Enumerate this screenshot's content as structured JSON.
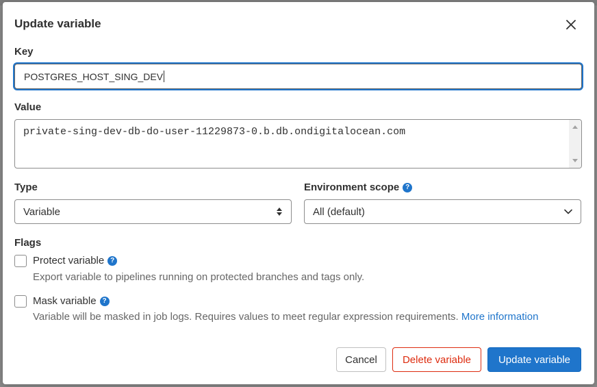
{
  "modal": {
    "title": "Update variable",
    "close_icon": "close-icon"
  },
  "key": {
    "label": "Key",
    "value": "POSTGRES_HOST_SING_DEV"
  },
  "value": {
    "label": "Value",
    "text": "private-sing-dev-db-do-user-11229873-0.b.db.ondigitalocean.com"
  },
  "type": {
    "label": "Type",
    "selected": "Variable",
    "icon": "sort-arrows-icon"
  },
  "environment": {
    "label": "Environment scope",
    "selected": "All (default)",
    "icon": "chevron-down-icon"
  },
  "flags": {
    "label": "Flags",
    "protect": {
      "label": "Protect variable",
      "checked": false,
      "help": "Export variable to pipelines running on protected branches and tags only."
    },
    "mask": {
      "label": "Mask variable",
      "checked": false,
      "help": "Variable will be masked in job logs. Requires values to meet regular expression requirements.",
      "link": "More information"
    }
  },
  "buttons": {
    "cancel": "Cancel",
    "delete": "Delete variable",
    "update": "Update variable"
  },
  "colors": {
    "primary": "#1f75cb",
    "danger": "#dd2b0e",
    "text": "#303030",
    "muted": "#666666"
  }
}
